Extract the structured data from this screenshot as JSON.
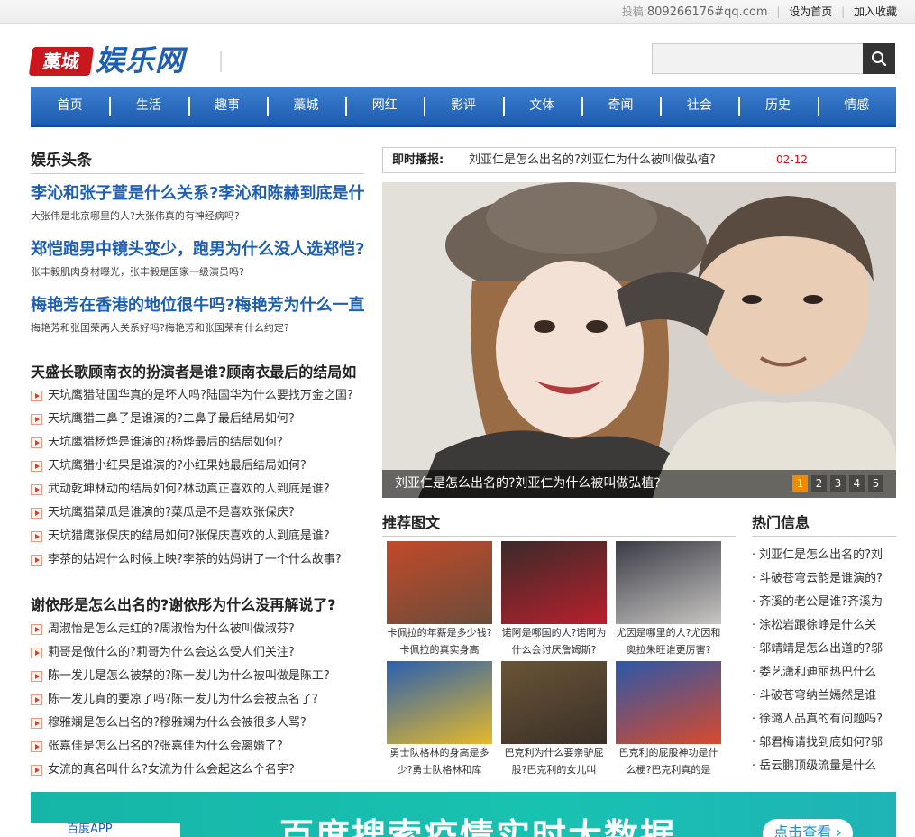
{
  "topbar": {
    "contribute_label": "投稿:",
    "contribute_email": "809266176#qq.com",
    "set_home": "设为首页",
    "add_fav": "加入收藏"
  },
  "header": {
    "logo_badge": "藁城",
    "logo_word": "娱乐网",
    "search_placeholder": ""
  },
  "nav": {
    "items": [
      "首页",
      "生活",
      "趣事",
      "藁城",
      "网红",
      "影评",
      "文体",
      "奇闻",
      "社会",
      "历史",
      "情感"
    ]
  },
  "left": {
    "section_title": "娱乐头条",
    "headlines": [
      {
        "title": "李沁和张子萱是什么关系?李沁和陈赫到底是什",
        "sub": "大张伟是北京哪里的人?大张伟真的有神经病吗?"
      },
      {
        "title": "郑恺跑男中镜头变少，跑男为什么没人选郑恺?",
        "sub": "张丰毅肌肉身材曝光，张丰毅是国家一级演员吗?"
      },
      {
        "title": "梅艳芳在香港的地位很牛吗?梅艳芳为什么一直",
        "sub": "梅艳芳和张国荣两人关系好吗?梅艳芳和张国荣有什么约定?"
      }
    ],
    "group1": {
      "title": "天盛长歌顾南衣的扮演者是谁?顾南衣最后的结局如",
      "items": [
        "天坑鹰猎陆国华真的是坏人吗?陆国华为什么要找万金之国?",
        "天坑鹰猎二鼻子是谁演的?二鼻子最后结局如何?",
        "天坑鹰猎杨烨是谁演的?杨烨最后的结局如何?",
        "天坑鹰猎小红果是谁演的?小红果她最后结局如何?",
        "武动乾坤林动的结局如何?林动真正喜欢的人到底是谁?",
        "天坑鹰猎菜瓜是谁演的?菜瓜是不是喜欢张保庆?",
        "天坑猎鹰张保庆的结局如何?张保庆喜欢的人到底是谁?",
        "李茶的姑妈什么时候上映?李茶的姑妈讲了一个什么故事?"
      ]
    },
    "group2": {
      "title": "谢依彤是怎么出名的?谢依彤为什么没再解说了?",
      "items": [
        "周淑怡是怎么走红的?周淑怡为什么被叫做淑芬?",
        "莉哥是做什么的?莉哥为什么会这么受人们关注?",
        "陈一发儿是怎么被禁的?陈一发儿为什么被叫做是陈工?",
        "陈一发儿真的要凉了吗?陈一发儿为什么会被点名了?",
        "穆雅斓是怎么出名的?穆雅斓为什么会被很多人骂?",
        "张嘉佳是怎么出名的?张嘉佳为什么会离婚了?",
        "女流的真名叫什么?女流为什么会起这么个名字?"
      ]
    }
  },
  "ticker": {
    "label": "即时播报:",
    "text": "刘亚仁是怎么出名的?刘亚仁为什么被叫做弘植?",
    "date": "02-12"
  },
  "slideshow": {
    "caption": "刘亚仁是怎么出名的?刘亚仁为什么被叫做弘植?",
    "pages": [
      "1",
      "2",
      "3",
      "4",
      "5"
    ],
    "active_page": "1"
  },
  "recommended": {
    "title": "推荐图文",
    "cards": [
      {
        "caption": "卡佩拉的年薪是多少钱?卡佩拉的真实身高",
        "color_top": "#c24a2a",
        "color_bottom": "#6b4c3a"
      },
      {
        "caption": "诺阿是哪国的人?诺阿为什么会讨厌詹姆斯?",
        "color_top": "#3a2a2a",
        "color_bottom": "#b8202c"
      },
      {
        "caption": "尤因是哪里的人?尤因和奥拉朱旺谁更厉害?",
        "color_top": "#3b3b46",
        "color_bottom": "#c8c6c2"
      },
      {
        "caption": "勇士队格林的身高是多少?勇士队格林和库",
        "color_top": "#2a5fb0",
        "color_bottom": "#e5b92a"
      },
      {
        "caption": "巴克利为什么要亲驴屁股?巴克利的女儿叫",
        "color_top": "#6a5436",
        "color_bottom": "#3a3028"
      },
      {
        "caption": "巴克利的屁股神功是什么梗?巴克利真的是",
        "color_top": "#2b58a8",
        "color_bottom": "#d84a2c"
      }
    ]
  },
  "hot": {
    "title": "热门信息",
    "items": [
      "刘亚仁是怎么出名的?刘",
      "斗破苍穹云韵是谁演的?",
      "齐溪的老公是谁?齐溪为",
      "涂松岩跟徐峥是什么关",
      "邬靖靖是怎么出道的?邬",
      "娄艺潇和迪丽热巴什么",
      "斗破苍穹纳兰嫣然是谁",
      "徐璐人品真的有问题吗?",
      "邬君梅请找到底如何?邬",
      "岳云鹏顶级流量是什么"
    ]
  },
  "banner": {
    "app_label": "百度APP",
    "main_text": "百度搜索疫情实时大数据",
    "button": "点击查看 ›"
  }
}
